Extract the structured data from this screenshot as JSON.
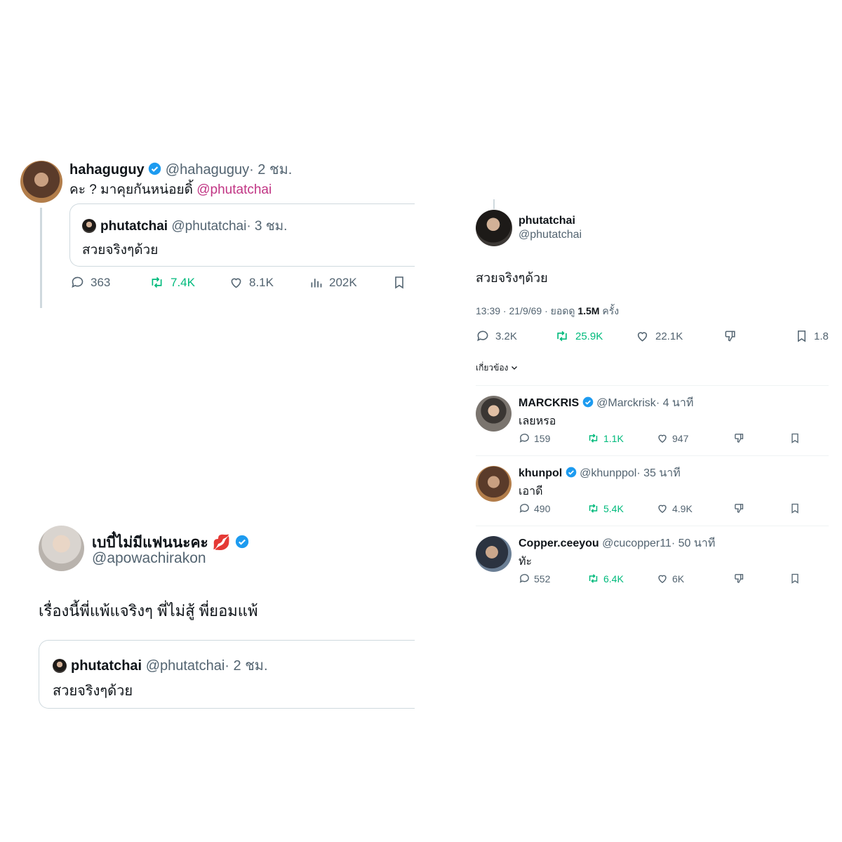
{
  "colors": {
    "verified": "#1d9bf0",
    "retweet": "#00ba7c",
    "mention": "#c13584",
    "muted": "#536471"
  },
  "tweet1": {
    "display_name": "hahaguguy",
    "handle": "@hahaguguy",
    "time": "· 2 ชม.",
    "text": "คะ ? มาคุยกันหน่อยดิ้",
    "mention": "@phutatchai",
    "quote": {
      "display_name": "phutatchai",
      "handle": "@phutatchai",
      "time": "· 3 ชม.",
      "text": "สวยจริงๆด้วย"
    },
    "stats": {
      "replies": "363",
      "retweets": "7.4K",
      "likes": "8.1K",
      "views": "202K"
    }
  },
  "tweet2": {
    "display_name": "เบบี๋ไม่มีแฟนนะคะ",
    "emoji": "💋",
    "handle": "@apowachirakon",
    "text": "เรื่องนี้พี่แพ้แจริงๆ พี่ไม่สู้  พี่ยอมแพ้",
    "quote": {
      "display_name": "phutatchai",
      "handle": "@phutatchai",
      "time": "· 2 ชม.",
      "text": "สวยจริงๆด้วย"
    }
  },
  "main": {
    "display_name": "phutatchai",
    "handle": "@phutatchai",
    "text": "สวยจริงๆด้วย",
    "meta_prefix": "13:39 · 21/9/69 · ยอดดู",
    "views": "1.5M",
    "meta_suffix": "ครั้ง",
    "stats": {
      "replies": "3.2K",
      "retweets": "25.9K",
      "likes": "22.1K",
      "bookmarks": "1.8"
    },
    "related_label": "เกี่ยวข้อง"
  },
  "replies": [
    {
      "display_name": "MARCKRIS",
      "verified": true,
      "handle": "@Marckrisk",
      "time": "· 4 นาที",
      "text": "เลยหรอ",
      "replies": "159",
      "retweets": "1.1K",
      "likes": "947"
    },
    {
      "display_name": "khunpol",
      "verified": true,
      "handle": "@khunppol",
      "time": "· 35 นาที",
      "text": "เอาดี",
      "replies": "490",
      "retweets": "5.4K",
      "likes": "4.9K"
    },
    {
      "display_name": "Copper.ceeyou",
      "verified": false,
      "handle": "@cucopper11",
      "time": "· 50 นาที",
      "text": "ทัะ",
      "replies": "552",
      "retweets": "6.4K",
      "likes": "6K"
    }
  ],
  "icons": [
    "reply-icon",
    "retweet-icon",
    "like-icon",
    "views-icon",
    "bookmark-icon",
    "dislike-icon",
    "verified-icon",
    "chevron-down-icon"
  ]
}
